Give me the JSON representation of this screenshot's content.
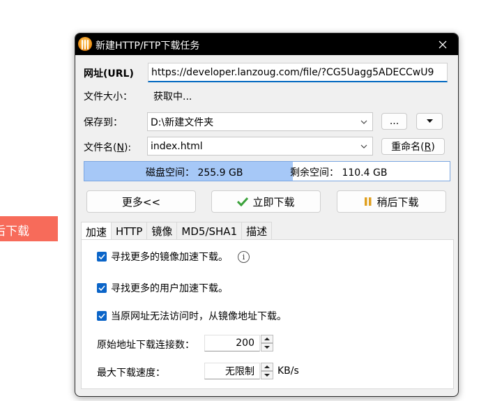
{
  "background": {
    "tag_text": "后下载",
    "tag_color": "#f76b5a"
  },
  "dialog": {
    "title": "新建HTTP/FTP下载任务",
    "app_icon": "flashget-orange-icon",
    "close_icon": "close-icon",
    "url_label": "网址(URL)",
    "url_value": "https://developer.lanzoug.com/file/?CG5Uagg5ADECCwU9",
    "filesize_label": "文件大小：",
    "filesize_value": "获取中...",
    "saveto_label": "保存到：",
    "saveto_value": "D:\\新建文件夹",
    "browse_label": "...",
    "filename_label_pre": "文件名(",
    "filename_label_key": "N",
    "filename_label_post": "):",
    "filename_value": "index.html",
    "rename_label_pre": "重命名(",
    "rename_label_key": "R",
    "rename_label_post": ")",
    "disk_space_label": "磁盘空间：",
    "disk_space_value": "255.9 GB",
    "free_space_label": "剩余空间：",
    "free_space_value": "110.4 GB",
    "disk_used_fraction": 0.57,
    "more_button": "更多<<",
    "download_now_button": "立即下载",
    "download_later_button": "稍后下载",
    "tabs": [
      "加速",
      "HTTP",
      "镜像",
      "MD5/SHA1",
      "描述"
    ],
    "active_tab": "加速",
    "options": {
      "mirror_accel": "寻找更多的镜像加速下载。",
      "user_accel": "寻找更多的用户加速下载。",
      "fallback_mirror": "当原网址无法访问时，从镜像地址下载。",
      "connections_label": "原始地址下载连接数：",
      "connections_value": "200",
      "max_speed_label": "最大下载速度：",
      "max_speed_value": "无限制",
      "max_speed_unit": "KB/s"
    },
    "accent_color": "#0a64c8"
  }
}
